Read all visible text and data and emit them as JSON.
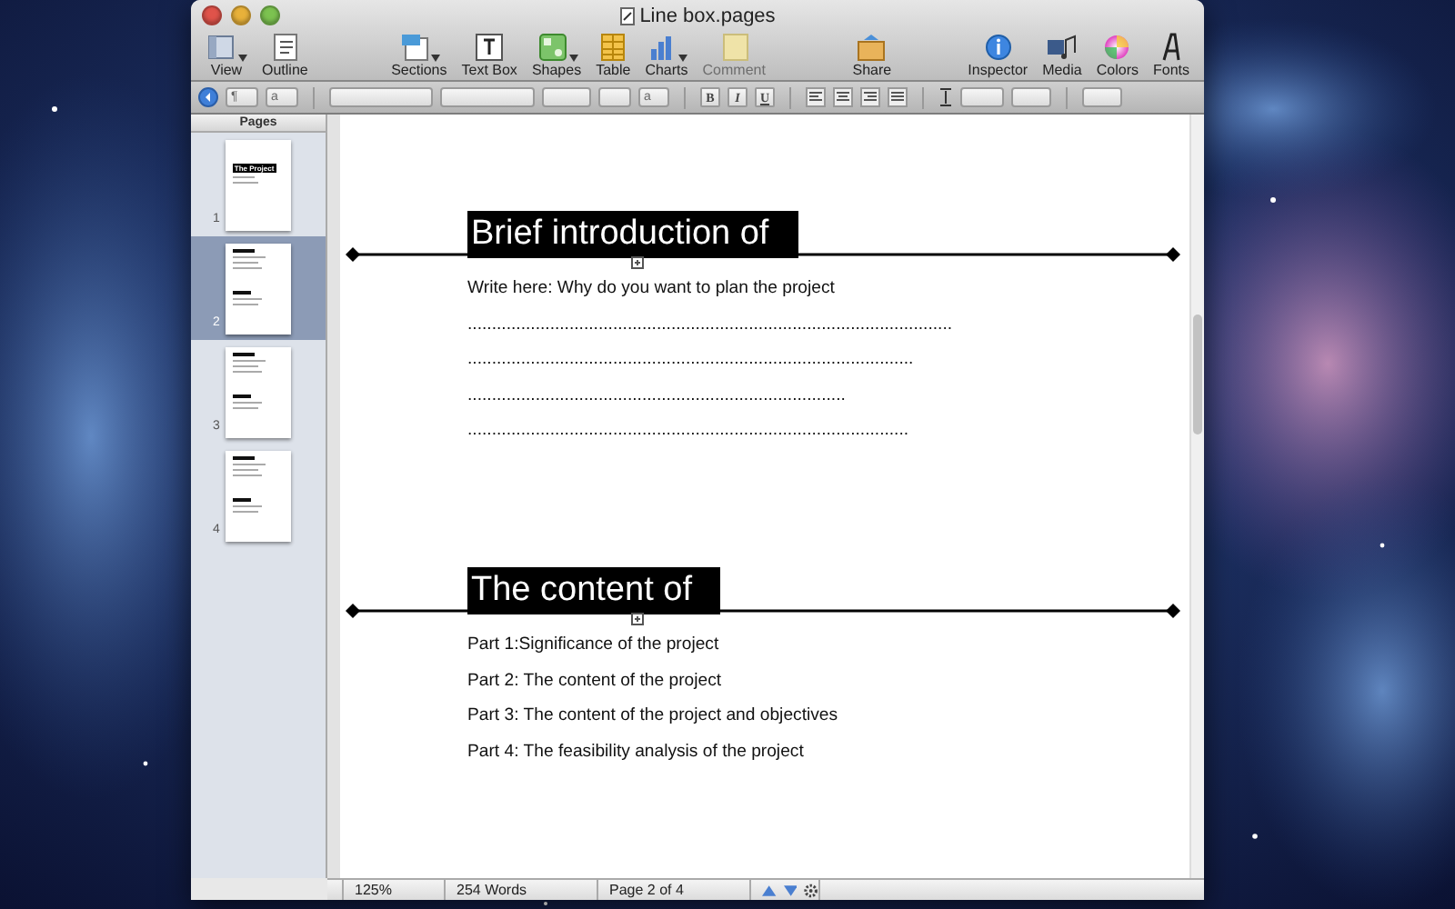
{
  "window": {
    "title": "Line box.pages"
  },
  "toolbar": {
    "left": [
      {
        "kind": "view",
        "label": "View",
        "menu": true,
        "disabled": false
      },
      {
        "kind": "outline",
        "label": "Outline",
        "menu": false,
        "disabled": false
      }
    ],
    "center": [
      {
        "kind": "sections",
        "label": "Sections",
        "menu": true,
        "disabled": false
      },
      {
        "kind": "textbox",
        "label": "Text Box",
        "menu": false,
        "disabled": false
      },
      {
        "kind": "shapes",
        "label": "Shapes",
        "menu": true,
        "disabled": false
      },
      {
        "kind": "table",
        "label": "Table",
        "menu": false,
        "disabled": false
      },
      {
        "kind": "charts",
        "label": "Charts",
        "menu": true,
        "disabled": false
      },
      {
        "kind": "comment",
        "label": "Comment",
        "menu": false,
        "disabled": true
      }
    ],
    "middle": [
      {
        "kind": "share",
        "label": "Share",
        "menu": false,
        "disabled": false
      }
    ],
    "right": [
      {
        "kind": "inspector",
        "label": "Inspector",
        "menu": false,
        "disabled": false
      },
      {
        "kind": "media",
        "label": "Media",
        "menu": false,
        "disabled": false
      },
      {
        "kind": "colors",
        "label": "Colors",
        "menu": false,
        "disabled": false
      },
      {
        "kind": "fonts",
        "label": "Fonts",
        "menu": false,
        "disabled": false
      }
    ]
  },
  "format_bar": {
    "paragraph_style": "¶",
    "character_style": "a",
    "fill_label": "a",
    "bold": "B",
    "italic": "I",
    "underline": "U"
  },
  "sidebar": {
    "title": "Pages",
    "pages": [
      {
        "number": "1",
        "selected": false,
        "thumb_title": "The Project"
      },
      {
        "number": "2",
        "selected": true
      },
      {
        "number": "3",
        "selected": false
      },
      {
        "number": "4",
        "selected": false
      }
    ]
  },
  "document": {
    "sections": [
      {
        "heading": "Brief introduction of",
        "lines": [
          "Write here: Why do you want to plan the project",
          "....................................................................................................",
          "............................................................................................",
          "..............................................................................",
          "..........................................................................................."
        ]
      },
      {
        "heading": "The content of",
        "lines": [
          "Part 1:Significance of the project",
          "Part 2: The content of the project",
          "Part 3: The content of the project and objectives",
          "Part 4: The feasibility analysis of the project"
        ]
      }
    ]
  },
  "status_bar": {
    "zoom": "125%",
    "words": "254 Words",
    "page": "Page 2 of 4"
  }
}
